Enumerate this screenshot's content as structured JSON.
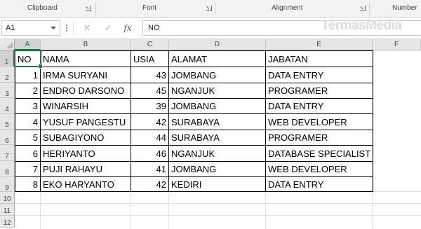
{
  "ribbon": {
    "groups": [
      {
        "label": "Clipboard"
      },
      {
        "label": "Font"
      },
      {
        "label": "Alignment"
      },
      {
        "label": "Number"
      }
    ]
  },
  "formula_bar": {
    "name_box": "A1",
    "cancel_symbol": "✕",
    "enter_symbol": "✓",
    "fx_label": "fx",
    "content": "NO"
  },
  "watermark": "TermasMedia",
  "sheet": {
    "columns": [
      "A",
      "B",
      "C",
      "D",
      "E",
      "F"
    ],
    "row_numbers": [
      "1",
      "2",
      "3",
      "4",
      "5",
      "6",
      "7",
      "8",
      "9",
      "10",
      "11",
      "12"
    ],
    "active_cell": "A1",
    "header": [
      "NO",
      "NAMA",
      "USIA",
      "ALAMAT",
      "JABATAN"
    ],
    "rows": [
      [
        "1",
        "IRMA SURYANI",
        "43",
        "JOMBANG",
        "DATA ENTRY"
      ],
      [
        "2",
        "ENDRO DARSONO",
        "45",
        "NGANJUK",
        "PROGRAMER"
      ],
      [
        "3",
        "WINARSIH",
        "39",
        "JOMBANG",
        "DATA ENTRY"
      ],
      [
        "4",
        "YUSUF PANGESTU",
        "42",
        "SURABAYA",
        "WEB DEVELOPER"
      ],
      [
        "5",
        "SUBAGIYONO",
        "44",
        "SURABAYA",
        "PROGRAMER"
      ],
      [
        "6",
        "HERIYANTO",
        "46",
        "NGANJUK",
        "DATABASE SPECIALIST"
      ],
      [
        "7",
        "PUJI RAHAYU",
        "41",
        "JOMBANG",
        "WEB DEVELOPER"
      ],
      [
        "8",
        "EKO HARYANTO",
        "42",
        "KEDIRI",
        "DATA ENTRY"
      ]
    ]
  },
  "colors": {
    "accent": "#217346",
    "header_bg": "#e6e6e6",
    "gridline": "#e1e1e1"
  }
}
